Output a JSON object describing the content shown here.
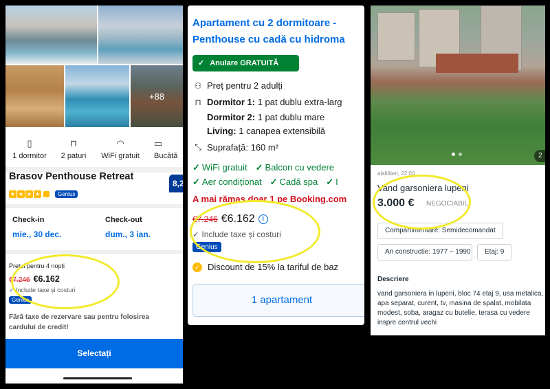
{
  "booking_mobile": {
    "photos": {
      "more_count": "+88"
    },
    "amenities": [
      {
        "icon": "door-icon",
        "glyph": "▯",
        "label": "1 dormitor"
      },
      {
        "icon": "bed-icon",
        "glyph": "⊓",
        "label": "2 paturi"
      },
      {
        "icon": "wifi-icon",
        "glyph": "◠",
        "label": "WiFi gratuit"
      },
      {
        "icon": "kitchen-icon",
        "glyph": "▭",
        "label": "Bucătă"
      }
    ],
    "hotel_name": "Brasov Penthouse Retreat",
    "score": "8,2",
    "genius_label": "Genius",
    "checkin_label": "Check-in",
    "checkin_value": "mie., 30 dec.",
    "checkout_label": "Check-out",
    "checkout_value": "dum., 3 ian.",
    "price_label": "Prețul pentru 4 nopți",
    "old_price": "€7.246",
    "new_price": "€6.162",
    "taxes": "✓ Include taxe și costuri",
    "fee_note": "Fără taxe de rezervare sau pentru folosirea cardului de credit!",
    "select_label": "Selectați"
  },
  "booking_room": {
    "title_line1": "Apartament cu 2 dormitoare -",
    "title_line2": "Penthouse cu cadă cu hidroma",
    "free_cancel": "Anulare GRATUITĂ",
    "price_for": "Preț pentru 2 adulți",
    "bedroom1_label": "Dormitor 1:",
    "bedroom1_value": " 1 pat dublu extra-larg",
    "bedroom2_label": "Dormitor 2:",
    "bedroom2_value": " 1 pat dublu mare",
    "living_label": "Living:",
    "living_value": " 1 canapea extensibilă",
    "area": "Suprafață: 160 m²",
    "features_row1": [
      "WiFi gratuit",
      "Balcon cu vedere"
    ],
    "features_row2": [
      "Aer condiționat",
      "Cadă spa",
      "I"
    ],
    "alert": "A mai rămas doar 1 pe Booking.com",
    "old_price": "€7.246",
    "new_price": "€6.162",
    "taxes": "✓ Include taxe și costuri",
    "genius_label": "Genius",
    "discount": "Discount de 15% la tariful de baz",
    "apt_button": "1 apartament"
  },
  "listing": {
    "photo_counter": "2",
    "date": "alaltăieri, 22:00",
    "title": "Vand garsoniera lupeni",
    "price": "3.000 €",
    "negotiable": "NEGOCIABIL",
    "chips": [
      "Compartimentare: Semidecomandat",
      "An constructie: 1977 – 1990",
      "Etaj: 9"
    ],
    "description_heading": "Descriere",
    "description": "vand garsoniera in lupeni, bloc 74 etaj 9, usa metalica, apa separat, curent, tv, masina de spalat, mobilata modest, soba, aragaz cu butelie, terasa cu vedere inspre centrul vechi"
  },
  "colors": {
    "booking_blue": "#006ce4",
    "genius_blue": "#004cb8",
    "green": "#008234",
    "red": "#d4111e",
    "highlight": "#f2ea2c"
  }
}
